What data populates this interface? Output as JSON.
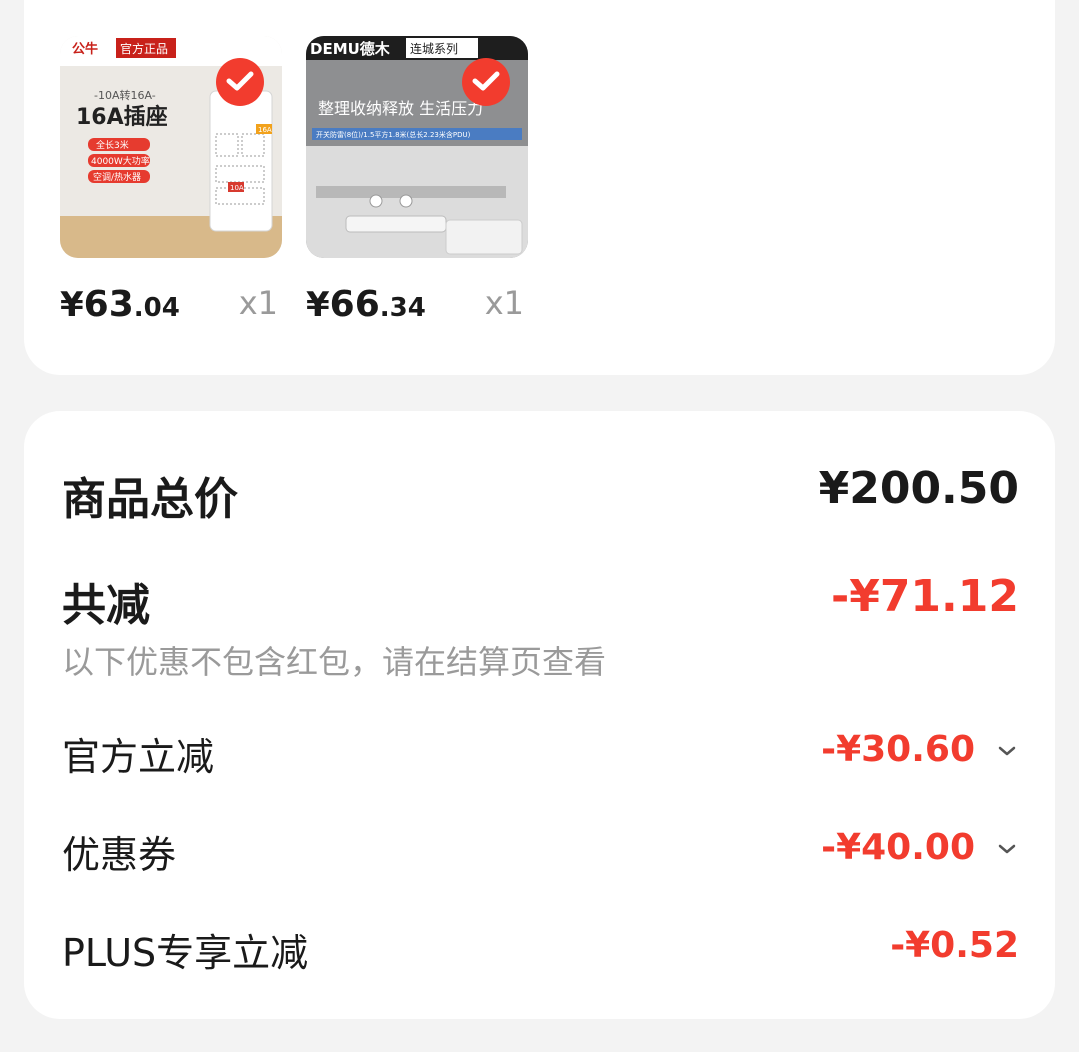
{
  "products": [
    {
      "image_text": {
        "brand": "公牛",
        "tag": "官方正品",
        "sub": "-10A转16A-",
        "headline": "16A插座",
        "feature1": "全长3米",
        "feature2": "4000W大功率",
        "feature3": "空调/热水器",
        "badge16": "16A",
        "badge10": "10A"
      },
      "price_yen": "¥",
      "price_int": "63",
      "price_dec": ".04",
      "quantity": "x1"
    },
    {
      "image_text": {
        "brand": "DEMU德木",
        "tag": "连城系列",
        "headline": "整理收纳释放 生活压力",
        "spec": "开关防雷(8位)/1.5平方1.8米(总长2.23米含PDU)"
      },
      "price_yen": "¥",
      "price_int": "66",
      "price_dec": ".34",
      "quantity": "x1"
    }
  ],
  "summary": {
    "total_label": "商品总价",
    "total_value": "¥200.50",
    "reduce_label": "共减",
    "reduce_value": "-¥71.12",
    "note": "以下优惠不包含红包，请在结算页查看",
    "lines": [
      {
        "label": "官方立减",
        "value": "-¥30.60",
        "expandable": true
      },
      {
        "label": "优惠券",
        "value": "-¥40.00",
        "expandable": true
      },
      {
        "label": "PLUS专享立减",
        "value": "-¥0.52",
        "expandable": false
      }
    ]
  },
  "colors": {
    "accent_red": "#f23c2e",
    "text_dark": "#1a1a1a",
    "text_gray": "#9a9a9a",
    "card_bg": "#ffffff",
    "page_bg": "#f3f3f3"
  },
  "icons": {
    "selected": "check-icon",
    "expand": "chevron-down-icon"
  }
}
